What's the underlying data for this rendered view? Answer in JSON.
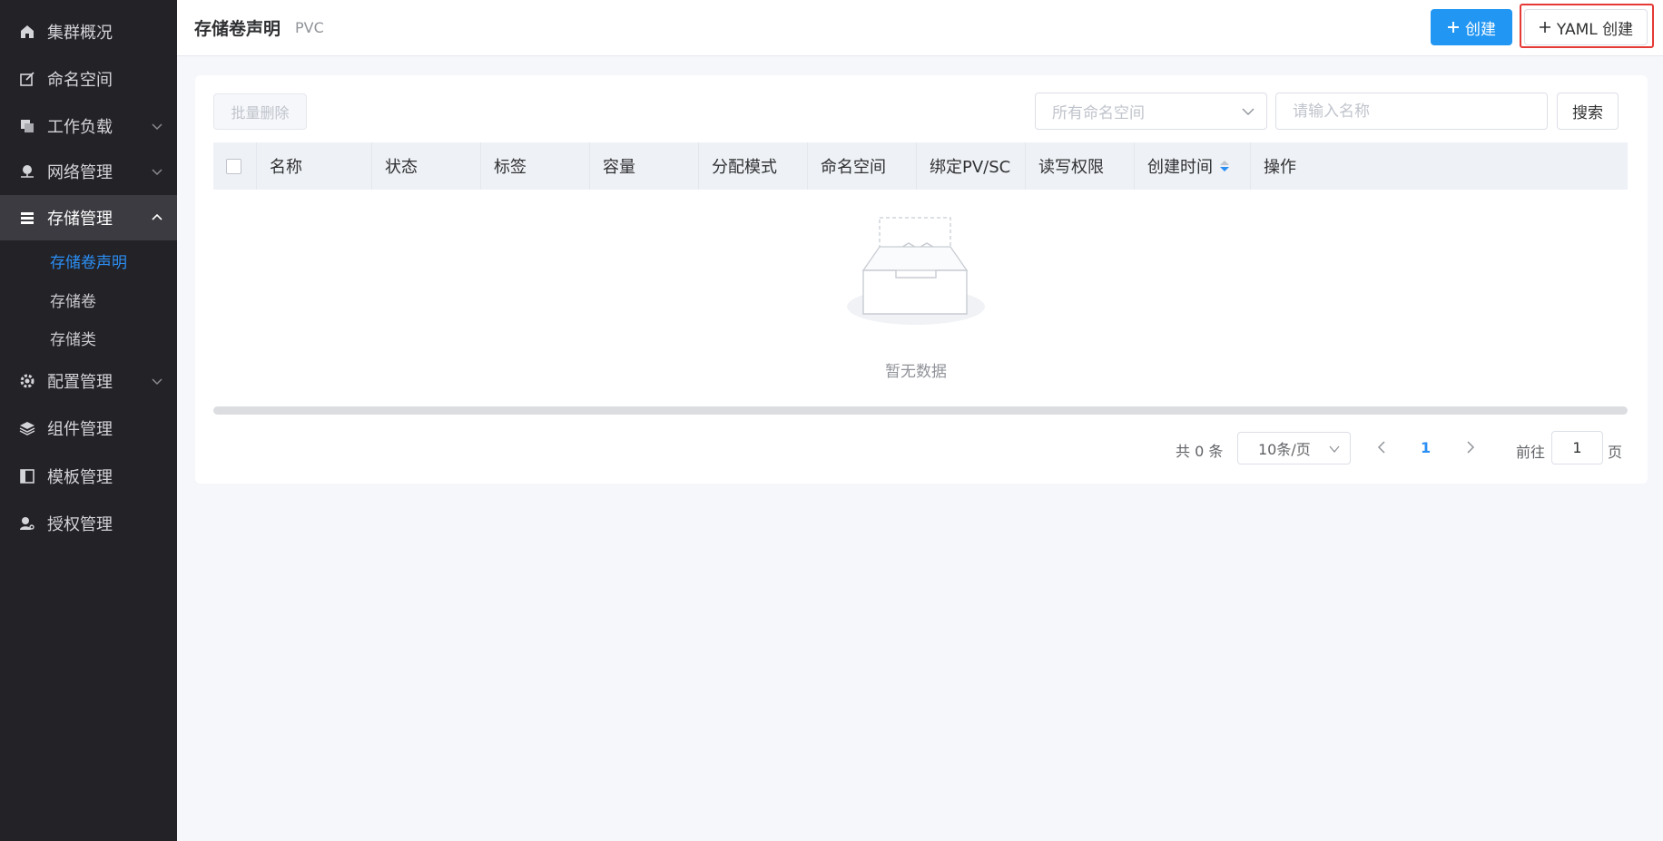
{
  "sidebar": {
    "items": [
      {
        "label": "集群概况",
        "icon": "home-icon"
      },
      {
        "label": "命名空间",
        "icon": "edit-square-icon"
      },
      {
        "label": "工作负载",
        "icon": "copy-icon"
      },
      {
        "label": "网络管理",
        "icon": "network-icon"
      },
      {
        "label": "存储管理",
        "icon": "storage-icon"
      },
      {
        "label": "配置管理",
        "icon": "gear-icon"
      },
      {
        "label": "组件管理",
        "icon": "layers-icon"
      },
      {
        "label": "模板管理",
        "icon": "template-icon"
      },
      {
        "label": "授权管理",
        "icon": "user-key-icon"
      }
    ],
    "sub_items": [
      {
        "label": "存储卷声明"
      },
      {
        "label": "存储卷"
      },
      {
        "label": "存储类"
      }
    ]
  },
  "header": {
    "title": "存储卷声明",
    "subtitle": "PVC",
    "create_label": "创建",
    "yaml_create_label": "YAML 创建"
  },
  "toolbar": {
    "batch_delete_label": "批量删除",
    "namespace_placeholder": "所有命名空间",
    "search_placeholder": "请输入名称",
    "search_label": "搜索"
  },
  "table": {
    "columns": [
      "名称",
      "状态",
      "标签",
      "容量",
      "分配模式",
      "命名空间",
      "绑定PV/SC",
      "读写权限",
      "创建时间",
      "操作"
    ],
    "rows": [],
    "empty_text": "暂无数据"
  },
  "pagination": {
    "total_text": "共 0 条",
    "page_size": "10条/页",
    "current_page": "1",
    "goto_label": "前往",
    "goto_value": "1",
    "goto_suffix": "页"
  },
  "colors": {
    "sidebar_bg": "#232227",
    "accent": "#2196f3",
    "highlight_border": "#e53935"
  }
}
